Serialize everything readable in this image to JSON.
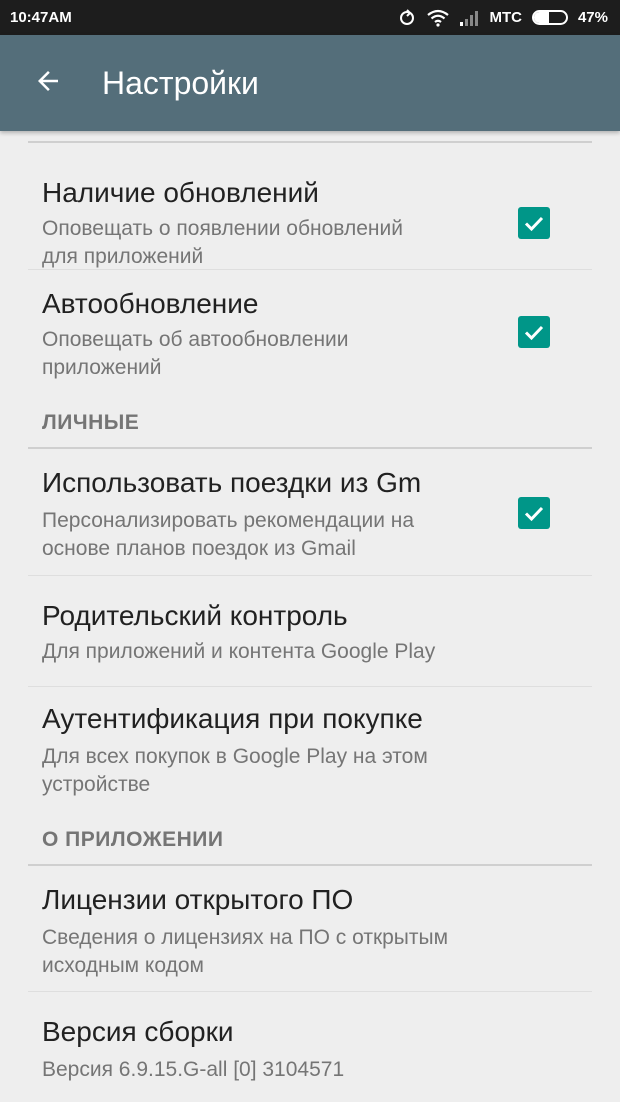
{
  "status_bar": {
    "time": "10:47AM",
    "carrier": "МТС",
    "battery_percent": "47%",
    "battery_level": 0.47
  },
  "app_bar": {
    "title": "Настройки",
    "color": "#546e7a"
  },
  "accent_color": "#009688",
  "sections": {
    "personal": "ЛИЧНЫЕ",
    "about": "О ПРИЛОЖЕНИИ"
  },
  "prefs": [
    {
      "title": "Наличие обновлений",
      "summary_line1": "Оповещать о появлении обновлений",
      "summary_line2": "для приложений",
      "checked": true
    },
    {
      "title": "Автообновление",
      "summary_line1": "Оповещать об автообновлении",
      "summary_line2": "приложений",
      "checked": true
    },
    {
      "title": "Использовать поездки из Gm",
      "summary_line1": "Персонализировать рекомендации на",
      "summary_line2": "основе планов поездок из Gmail",
      "checked": true
    },
    {
      "title": "Родительский контроль",
      "summary_line1": "Для приложений и контента Google Play"
    },
    {
      "title": "Аутентификация при покупке",
      "summary_line1": "Для всех покупок в Google Play на этом",
      "summary_line2": "устройстве"
    },
    {
      "title": "Лицензии открытого ПО",
      "summary_line1": "Сведения о лицензиях на ПО с открытым",
      "summary_line2": "исходным кодом"
    },
    {
      "title": "Версия сборки",
      "summary_line1": "Версия 6.9.15.G-all [0] 3104571"
    }
  ]
}
